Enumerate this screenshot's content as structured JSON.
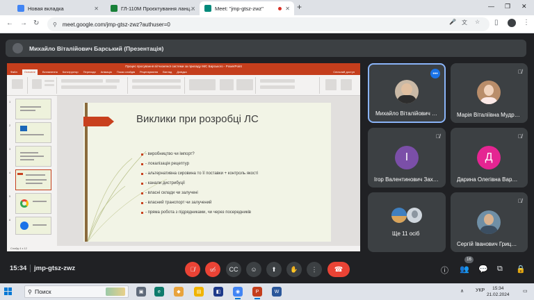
{
  "browser": {
    "tabs": [
      {
        "title": "Новая вкладка",
        "favicon_color": "#4285f4",
        "active": false
      },
      {
        "title": "ГЛ-110М Проєктування ланц…",
        "favicon_color": "#188038",
        "active": false
      },
      {
        "title": "Meet: \"jmp-gtsz-zwz\"",
        "favicon_color": "#00897b",
        "active": true
      }
    ],
    "url": "meet.google.com/jmp-gtsz-zwz?authuser=0"
  },
  "presenter_bar": {
    "text": "Михайло Віталійович Барський (Презентація)"
  },
  "powerpoint": {
    "window_title": "Процес просування вітчизняної системи за приладу ІМС Барського - PowerPoint",
    "tabs": [
      "Файл",
      "Основне",
      "Вставлення",
      "Конструктор",
      "Переходи",
      "Анімація",
      "Показ слайдів",
      "Рецензування",
      "Вигляд",
      "Довідка",
      "Спільний доступ"
    ],
    "selected_tab": "Основне",
    "status_left": "Слайд 4 з 12",
    "slide": {
      "title": "Виклики при розробці ЛС",
      "bullets": [
        "- виробництво чи імпорт?",
        "- локалізація рецептур",
        "- альтернативна сировина то її поставки + контроль якості",
        "- канали дистрибуції",
        "- власні склади чи залучені",
        "- власний транспорт чи залучений",
        "- пряма робота з підрядниками, чи через посередників"
      ]
    },
    "thumbnails": [
      "1",
      "2",
      "3",
      "4",
      "5",
      "6"
    ],
    "selected_thumbnail": "4"
  },
  "participants": [
    {
      "name": "Михайло Віталійович …",
      "speaking": true,
      "muted": false,
      "avatar": "photo",
      "more_icon": "more-vert-icon"
    },
    {
      "name": "Марія Віталіївна Мудр…",
      "speaking": false,
      "muted": true,
      "avatar": "photo"
    },
    {
      "name": "Ігор Валентинович Зах…",
      "speaking": false,
      "muted": true,
      "avatar": "letter",
      "letter": "І",
      "avatar_color": "#7b4fa8"
    },
    {
      "name": "Дарина Олегівна Вар…",
      "speaking": false,
      "muted": true,
      "avatar": "letter",
      "letter": "Д",
      "avatar_color": "#e52592"
    },
    {
      "name": "Ще 11 осіб",
      "speaking": false,
      "muted": false,
      "avatar": "group"
    },
    {
      "name": "Сергій Іванович Гриц…",
      "speaking": false,
      "muted": true,
      "avatar": "photo"
    }
  ],
  "meet_bar": {
    "time": "15:34",
    "meeting_code": "jmp-gtsz-zwz",
    "participant_count": "16",
    "controls": [
      "mic-off-icon",
      "camera-off-icon",
      "captions-icon",
      "emoji-icon",
      "present-icon",
      "raise-hand-icon",
      "more-icon"
    ]
  },
  "taskbar": {
    "search_label": "Поиск",
    "language": "УКР",
    "time": "15:34",
    "date": "21.02.2024"
  },
  "colors": {
    "meet_background": "#202124",
    "tile": "#3c4043",
    "danger": "#ea4335",
    "accent": "#8ab4f8",
    "powerpoint": "#c43e1c"
  }
}
